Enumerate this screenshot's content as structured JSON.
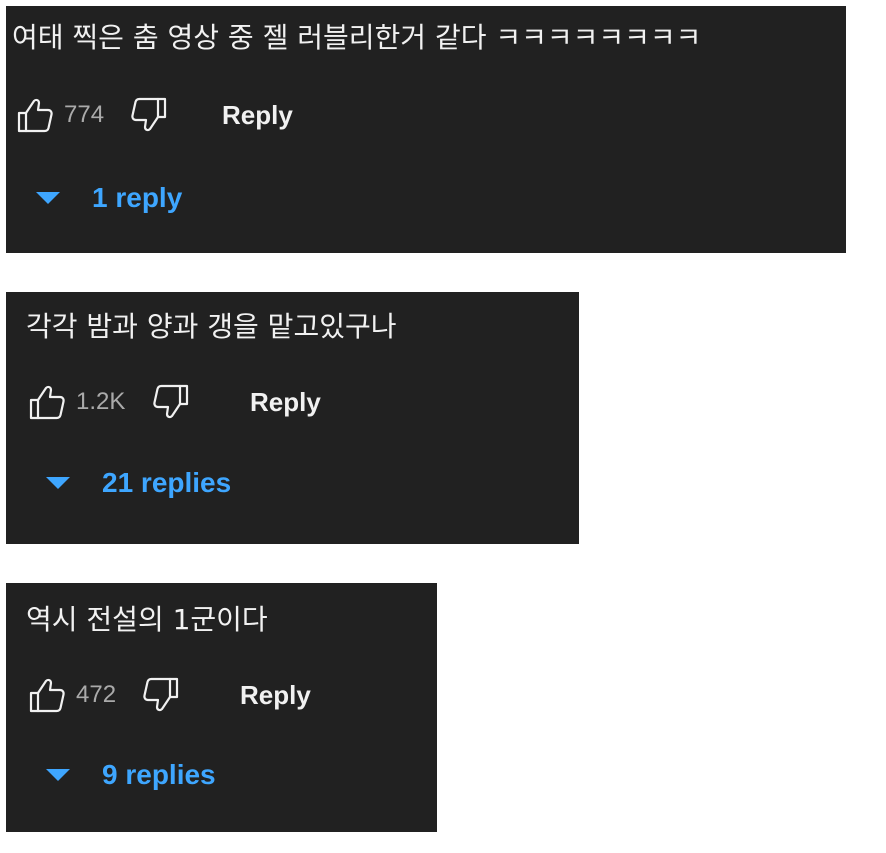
{
  "comments": [
    {
      "text": "여태 찍은 춤 영상 중 젤 러블리한거 같다 ㅋㅋㅋㅋㅋㅋㅋㅋ",
      "likes": "774",
      "reply_label": "Reply",
      "replies_label": "1 reply"
    },
    {
      "text": "각각 밤과 양과 갱을 맡고있구나",
      "likes": "1.2K",
      "reply_label": "Reply",
      "replies_label": "21 replies"
    },
    {
      "text": "역시 전설의 1군이다",
      "likes": "472",
      "reply_label": "Reply",
      "replies_label": "9 replies"
    }
  ],
  "colors": {
    "card_background": "#212121",
    "text_primary": "#f1f1f1",
    "text_secondary": "#aaaaaa",
    "accent_blue": "#3ea6ff"
  },
  "icons": [
    "thumbs-up-icon",
    "thumbs-down-icon",
    "caret-down-icon"
  ]
}
